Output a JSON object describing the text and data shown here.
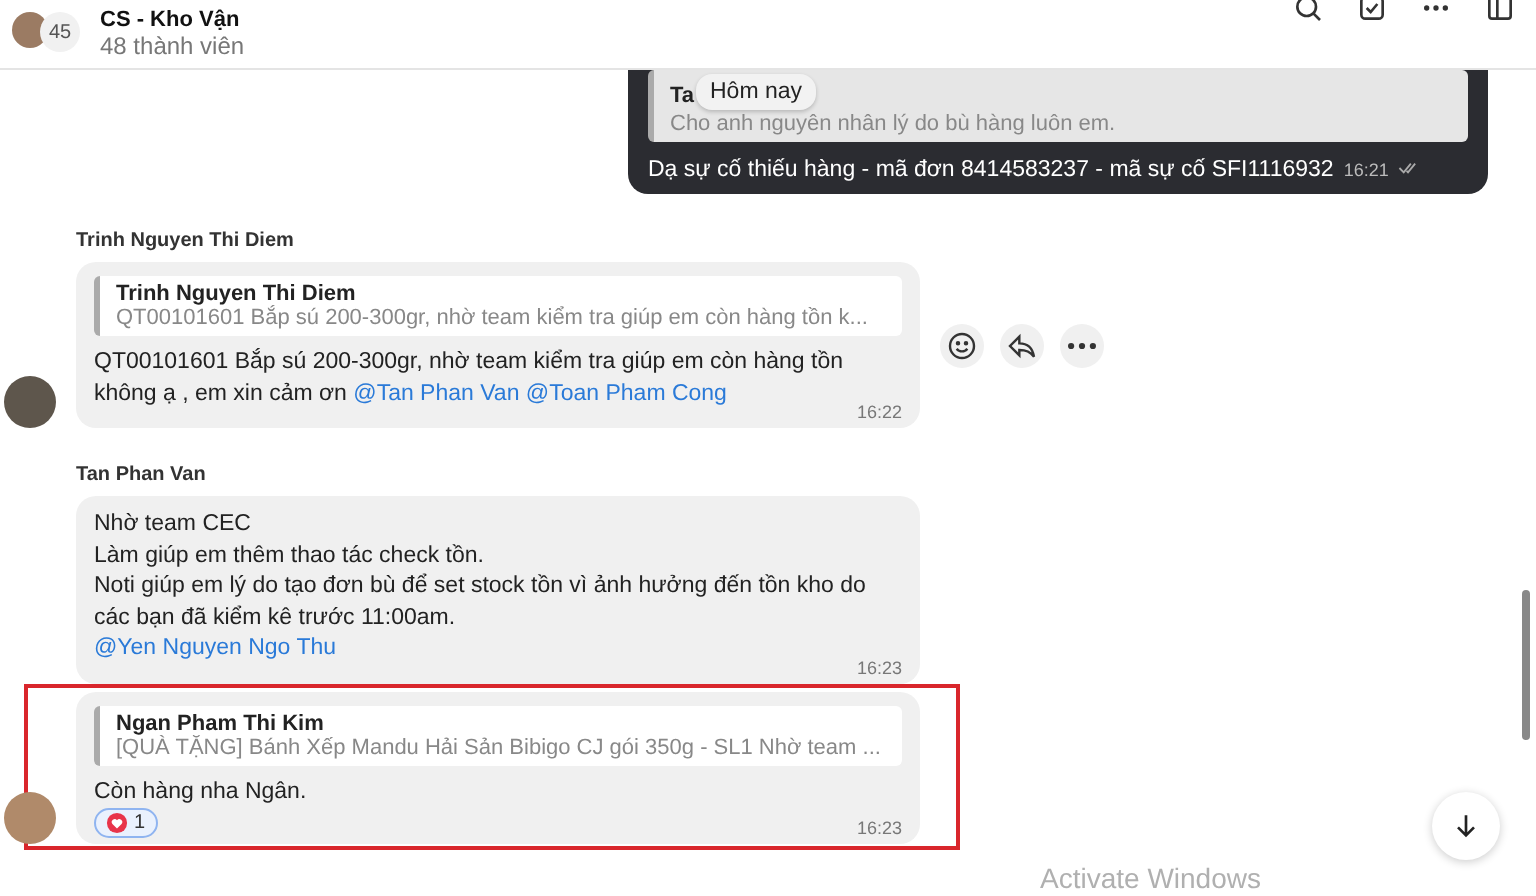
{
  "header": {
    "title": "CS - Kho Vận",
    "avatar_count": "45",
    "members": "48 thành viên"
  },
  "date_chip": "Hôm nay",
  "outgoing": {
    "quote": {
      "author": "Ta",
      "text": "Cho anh nguyên nhân lý do bù hàng luôn em."
    },
    "text": "Dạ sự cố thiếu hàng - mã đơn 8414583237 - mã sự cố SFI1116932",
    "time": "16:21",
    "read": true
  },
  "groups": [
    {
      "sender": "Trinh Nguyen Thi Diem",
      "messages": [
        {
          "quote": {
            "author": "Trinh Nguyen Thi Diem",
            "text": "QT00101601 Bắp sú 200-300gr, nhờ team kiểm tra giúp em còn hàng tồn k..."
          },
          "body": [
            {
              "kind": "text",
              "text": "QT00101601 Bắp sú 200-300gr, nhờ team kiểm tra giúp em còn hàng tồn không ạ , em xin cảm ơn "
            },
            {
              "kind": "mention",
              "text": "@Tan Phan Van"
            },
            {
              "kind": "mention",
              "text": "@Toan Pham Cong"
            }
          ],
          "time": "16:22",
          "hovered": true,
          "highlighted": false
        }
      ]
    },
    {
      "sender": "Tan Phan Van",
      "messages": [
        {
          "body": [
            {
              "kind": "text",
              "text": "Nhờ team CEC"
            },
            {
              "kind": "break"
            },
            {
              "kind": "text",
              "text": "Làm giúp em thêm thao tác check tồn."
            },
            {
              "kind": "break"
            },
            {
              "kind": "text",
              "text": "Noti giúp em lý do tạo đơn bù để set stock tồn vì ảnh hưởng đến tồn kho do các bạn đã kiểm kê trước 11:00am."
            },
            {
              "kind": "break"
            },
            {
              "kind": "mention",
              "text": "@Yen Nguyen Ngo Thu"
            }
          ],
          "time": "16:23",
          "hovered": false,
          "highlighted": false
        },
        {
          "quote": {
            "author": "Ngan Pham Thi Kim",
            "text": "[QUÀ TẶNG] Bánh Xếp Mandu Hải Sản Bibigo CJ gói 350g - SL1 Nhờ team ..."
          },
          "body": [
            {
              "kind": "text",
              "text": "Còn hàng nha Ngân."
            }
          ],
          "reaction_count": "1",
          "time": "16:23",
          "hovered": false,
          "highlighted": true
        }
      ]
    }
  ],
  "os_notice": "Activate Windows"
}
